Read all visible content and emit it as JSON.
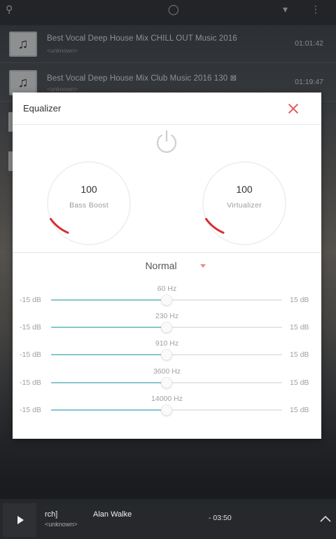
{
  "tracks": [
    {
      "title": "Best Vocal Deep House Mix  CHILL OUT Music 2016",
      "subtitle": "<unknown>",
      "duration": "01:01:42"
    },
    {
      "title": "Best Vocal Deep House Mix  Club Music 2016 130 ⊠",
      "subtitle": "<unknown>",
      "duration": "01:19:47"
    }
  ],
  "equalizer": {
    "title": "Equalizer",
    "bass_boost": {
      "value": "100",
      "label": "Bass Boost"
    },
    "virtualizer": {
      "value": "100",
      "label": "Virtualizer"
    },
    "preset": "Normal",
    "min_label": "-15 dB",
    "max_label": "15 dB",
    "bands": [
      {
        "freq": "60 Hz",
        "level": 0.5
      },
      {
        "freq": "230 Hz",
        "level": 0.5
      },
      {
        "freq": "910 Hz",
        "level": 0.5
      },
      {
        "freq": "3600 Hz",
        "level": 0.5
      },
      {
        "freq": "14000 Hz",
        "level": 0.5
      }
    ],
    "accent_color": "#87c7cf",
    "close_color": "#e06060",
    "knob_arc_color": "#d62f2f"
  },
  "player": {
    "title_fragment": "rch]",
    "artist": "Alan Walke",
    "subtitle": "<unknown>",
    "time": "- 03:50"
  }
}
